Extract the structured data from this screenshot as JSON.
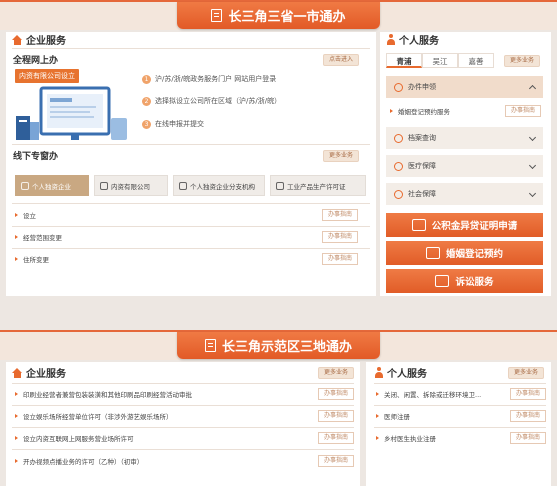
{
  "top_banner": {
    "title": "长三角三省一市通办"
  },
  "enterprise": {
    "title": "企业服务",
    "online": {
      "title": "全程网上办",
      "more": "点击进入",
      "tag": "内资有限公司设立",
      "steps": [
        {
          "num": "1",
          "text": "沪/苏/浙/皖政务服务门户 网站用户登录"
        },
        {
          "num": "2",
          "text": "选择拟设立公司所在区域（沪/苏/浙/皖）"
        },
        {
          "num": "3",
          "text": "在线申报并提交"
        }
      ]
    },
    "offline": {
      "title": "线下专窗办",
      "more": "更多业务",
      "categories": [
        "个人独资企业",
        "内资有限公司",
        "个人独资企业分支机构",
        "工业产品生产许可证"
      ],
      "rows": [
        {
          "label": "设立",
          "btn": "办事指南"
        },
        {
          "label": "经营范围变更",
          "btn": "办事指南"
        },
        {
          "label": "住所变更",
          "btn": "办事指南"
        }
      ]
    }
  },
  "personal": {
    "title": "个人服务",
    "tabs": [
      "青浦",
      "吴江",
      "嘉善"
    ],
    "more": "更多业务",
    "accordion": [
      {
        "label": "办件申领",
        "open": true
      },
      {
        "label": "档案查询"
      },
      {
        "label": "医疗保障"
      },
      {
        "label": "社会保障"
      }
    ],
    "open_item": {
      "label": "婚姻登记预约服务",
      "btn": "办事指南"
    },
    "big_buttons": [
      "公积金异贷证明申请",
      "婚姻登记预约",
      "诉讼服务"
    ]
  },
  "bottom_banner": {
    "title": "长三角示范区三地通办"
  },
  "enterprise2": {
    "title": "企业服务",
    "more": "更多业务",
    "rows": [
      {
        "label": "印刷业经营者兼营包装装潢和其他印刷品印刷经营活动审批",
        "btn": "办事指南"
      },
      {
        "label": "设立娱乐场所经营单位许可（非涉外游艺娱乐场所）",
        "btn": "办事指南"
      },
      {
        "label": "设立内资互联网上网服务营业场所许可",
        "btn": "办事指南"
      },
      {
        "label": "开办视频点播业务的许可（乙种）（初审）",
        "btn": "办事指南"
      }
    ]
  },
  "personal2": {
    "title": "个人服务",
    "more": "更多业务",
    "rows": [
      {
        "label": "关闭、闲置、拆除或迁移环境卫...",
        "btn": "办事指南"
      },
      {
        "label": "医师注册",
        "btn": "办事指南"
      },
      {
        "label": "乡村医生执业注册",
        "btn": "办事指南"
      }
    ]
  }
}
